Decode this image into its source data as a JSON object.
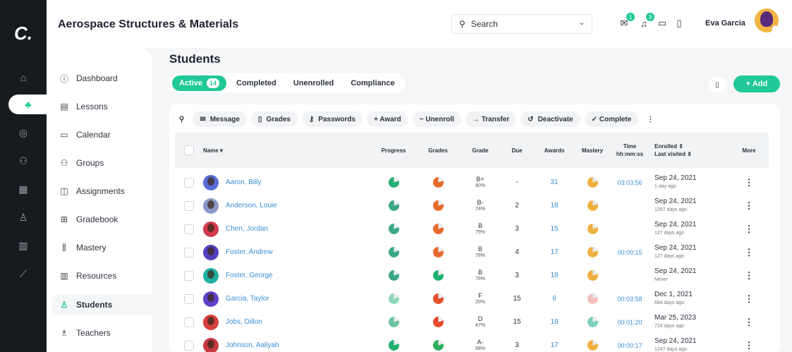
{
  "app": {
    "course_title": "Aerospace Structures & Materials",
    "logo": "C.",
    "accent": "#20c997"
  },
  "rail": {
    "icons": [
      "home-icon",
      "network-icon",
      "target-icon",
      "group-icon",
      "grid-icon",
      "user-icon",
      "library-icon",
      "chart-icon"
    ],
    "active_index": 1
  },
  "topbar": {
    "search_label": "Search",
    "notifications": {
      "messages_count": "1",
      "alerts_count": "3"
    },
    "user_name": "Eva Garcia"
  },
  "sidebar": {
    "items": [
      {
        "label": "Dashboard",
        "icon": "info-icon"
      },
      {
        "label": "Lessons",
        "icon": "lessons-icon"
      },
      {
        "label": "Calendar",
        "icon": "calendar-icon"
      },
      {
        "label": "Groups",
        "icon": "groups-icon"
      },
      {
        "label": "Assignments",
        "icon": "assignments-icon"
      },
      {
        "label": "Gradebook",
        "icon": "gradebook-icon"
      },
      {
        "label": "Mastery",
        "icon": "mastery-icon"
      },
      {
        "label": "Resources",
        "icon": "resources-icon"
      },
      {
        "label": "Students",
        "icon": "students-icon",
        "active": true
      },
      {
        "label": "Teachers",
        "icon": "teachers-icon"
      }
    ]
  },
  "main": {
    "page_title": "Students",
    "tabs": [
      {
        "label": "Active",
        "count": "14",
        "active": true
      },
      {
        "label": "Completed"
      },
      {
        "label": "Unenrolled"
      },
      {
        "label": "Compliance"
      }
    ],
    "add_label": "+ Add",
    "toolbar": {
      "message": "Message",
      "grades": "Grades",
      "passwords": "Passwords",
      "award": "+ Award",
      "unenroll": "− Unenroll",
      "transfer": "→ Transfer",
      "deactivate": "Deactivate",
      "complete": "✓ Complete"
    },
    "columns": {
      "name": "Name",
      "progress": "Progress",
      "grades": "Grades",
      "grade": "Grade",
      "due": "Due",
      "awards": "Awards",
      "mastery": "Mastery",
      "time_1": "Time",
      "time_2": "hh:mm:ss",
      "enrolled_1": "Enrolled ⇕",
      "enrolled_2": "Last visited ⇕",
      "more": "More"
    },
    "rows": [
      {
        "name": "Aaron, Billy",
        "grade": "B+",
        "pct": "80%",
        "due": "-",
        "awards": "31",
        "time": "03:03:56",
        "enrolled": "Sep 24, 2021",
        "visited": "1 day ago",
        "avatar_color": "#5b6bd6",
        "progress_color": "#20b070",
        "grades_color": "#e86a2c",
        "mastery_color": "#f0b040"
      },
      {
        "name": "Anderson, Louie",
        "grade": "B-",
        "pct": "74%",
        "due": "2",
        "awards": "18",
        "time": "",
        "enrolled": "Sep 24, 2021",
        "visited": "1267 days ago",
        "avatar_color": "#8a98c8",
        "progress_color": "#3aa886",
        "grades_color": "#e86a2c",
        "mastery_color": "#f0b040"
      },
      {
        "name": "Chen, Jordan",
        "grade": "B",
        "pct": "79%",
        "due": "3",
        "awards": "15",
        "time": "",
        "enrolled": "Sep 24, 2021",
        "visited": "127 days ago",
        "avatar_color": "#d23a4a",
        "progress_color": "#3aa886",
        "grades_color": "#e86a2c",
        "mastery_color": "#f0b040"
      },
      {
        "name": "Foster, Andrew",
        "grade": "B",
        "pct": "78%",
        "due": "4",
        "awards": "17",
        "time": "00:00:15",
        "enrolled": "Sep 24, 2021",
        "visited": "127 days ago",
        "avatar_color": "#5240c0",
        "progress_color": "#3aa886",
        "grades_color": "#e86a2c",
        "mastery_color": "#f0b040"
      },
      {
        "name": "Foster, George",
        "grade": "B",
        "pct": "76%",
        "due": "3",
        "awards": "18",
        "time": "",
        "enrolled": "Sep 24, 2021",
        "visited": "Never",
        "avatar_color": "#20b0a0",
        "progress_color": "#3aa886",
        "grades_color": "#20b070",
        "mastery_color": "#f0b040"
      },
      {
        "name": "Garcia, Taylor",
        "grade": "F",
        "pct": "20%",
        "due": "15",
        "awards": "6",
        "time": "00:03:58",
        "enrolled": "Dec 1, 2021",
        "visited": "684 days ago",
        "avatar_color": "#6040c8",
        "progress_color": "#8fd6b8",
        "grades_color": "#e8502c",
        "mastery_color": "#f5c0c0"
      },
      {
        "name": "Jobs, Dillon",
        "grade": "D",
        "pct": "47%",
        "due": "15",
        "awards": "18",
        "time": "00:01:20",
        "enrolled": "Mar 25, 2023",
        "visited": "724 days ago",
        "avatar_color": "#d84040",
        "progress_color": "#6cc4a0",
        "grades_color": "#e84a2c",
        "mastery_color": "#7fd0c0"
      },
      {
        "name": "Johnson, Aaliyah",
        "grade": "A-",
        "pct": "88%",
        "due": "3",
        "awards": "17",
        "time": "00:00:17",
        "enrolled": "Sep 24, 2021",
        "visited": "1247 days ago",
        "avatar_color": "#c83a40",
        "progress_color": "#20b070",
        "grades_color": "#30b060",
        "mastery_color": "#f0b040"
      }
    ]
  }
}
